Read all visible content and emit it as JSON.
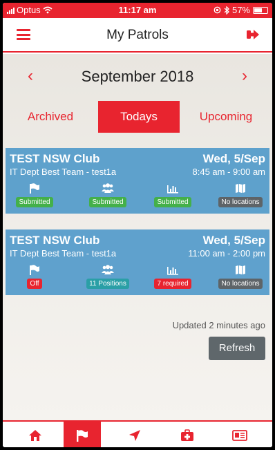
{
  "status_bar": {
    "carrier": "Optus",
    "time": "11:17 am",
    "battery": "57%"
  },
  "header": {
    "title": "My Patrols"
  },
  "month_nav": {
    "month": "September 2018"
  },
  "tabs": [
    {
      "label": "Archived",
      "active": false
    },
    {
      "label": "Todays",
      "active": true
    },
    {
      "label": "Upcoming",
      "active": false
    }
  ],
  "patrols": [
    {
      "club": "TEST NSW Club",
      "date": "Wed, 5/Sep",
      "team": "IT Dept Best Team - test1a",
      "time": "8:45 am - 9:00 am",
      "stats": [
        {
          "icon": "flag-icon",
          "label": "Submitted",
          "color": "#44b04a"
        },
        {
          "icon": "users-icon",
          "label": "Submitted",
          "color": "#44b04a"
        },
        {
          "icon": "bar-chart-icon",
          "label": "Submitted",
          "color": "#44b04a"
        },
        {
          "icon": "map-icon",
          "label": "No locations",
          "color": "#5e6468"
        }
      ]
    },
    {
      "club": "TEST NSW Club",
      "date": "Wed, 5/Sep",
      "team": "IT Dept Best Team - test1a",
      "time": "11:00 am - 2:00 pm",
      "stats": [
        {
          "icon": "flag-icon",
          "label": "Off",
          "color": "#e8242f"
        },
        {
          "icon": "users-icon",
          "label": "11 Positions",
          "color": "#2a9fa6"
        },
        {
          "icon": "bar-chart-icon",
          "label": "7 required",
          "color": "#e8242f"
        },
        {
          "icon": "map-icon",
          "label": "No locations",
          "color": "#5e6468"
        }
      ]
    }
  ],
  "footer": {
    "updated": "Updated 2 minutes ago",
    "refresh_label": "Refresh"
  },
  "bottom_nav": [
    {
      "icon": "home-icon",
      "active": false
    },
    {
      "icon": "flag-icon",
      "active": true
    },
    {
      "icon": "location-arrow-icon",
      "active": false
    },
    {
      "icon": "first-aid-icon",
      "active": false
    },
    {
      "icon": "id-card-icon",
      "active": false
    }
  ],
  "colors": {
    "accent": "#e8242f",
    "card": "#4a96c8"
  }
}
